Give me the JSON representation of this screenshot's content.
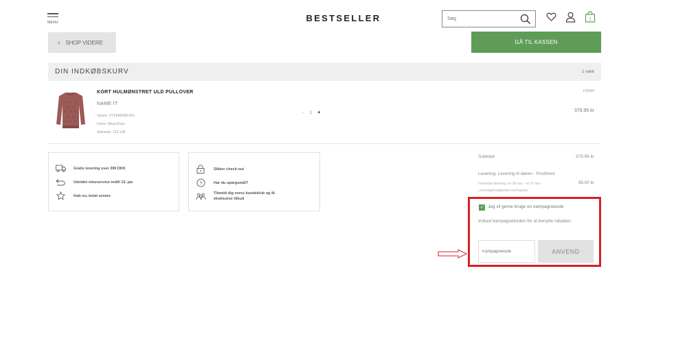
{
  "header": {
    "menu_label": "MENU",
    "logo": "BESTSELLER",
    "search_placeholder": "Søg"
  },
  "actions": {
    "shop_videre": "SHOP VIDERE",
    "checkout": "GÅ TIL KASSEN"
  },
  "cart": {
    "title": "DIN INDKØBSKURV",
    "count": "1 vare",
    "item": {
      "name": "KORT HULMØNSTRET ULD PULLOVER",
      "brand": "NAME IT",
      "item_no": "Varenr.: 5714489981419",
      "color": "Farve: Mesa Rose",
      "size": "Størrelse: 122-128",
      "qty_minus": "-",
      "qty": "1",
      "qty_plus": "+",
      "remove": "FJERN",
      "price": "379,95 kr"
    }
  },
  "info_left": [
    {
      "icon": "truck-icon",
      "text": "Gratis levering over 399 DKK"
    },
    {
      "icon": "return-arrow-icon",
      "text": "Udvidet returservice indtil 15. jan"
    },
    {
      "icon": "star-icon",
      "text": "Køb nu, betal senere"
    }
  ],
  "info_right": [
    {
      "icon": "lock-icon",
      "text": "Sikker check-out"
    },
    {
      "icon": "question-icon",
      "text": "Har du spørgsmål?"
    },
    {
      "icon": "people-icon",
      "text_line1": "Tilmeld dig vores kundeklub og få",
      "text_line2": "eksklusive tilbud"
    }
  ],
  "summary": {
    "subtotal_label": "Subtotal",
    "subtotal_value": "379,95 kr",
    "delivery_label": "Levering: Levering til døren - PostNord",
    "delivery_expected": "Forventet levering: on 06 nov. - to 07 nov.",
    "delivery_value": "39,00 kr",
    "delivery_options": "Leveringsmuligheder ved kassen"
  },
  "campaign": {
    "checkbox_label": "Jeg vil gerne bruge en kampagnekode",
    "checked": true,
    "description": "Indtast kampagnekoden for at benytte rabatten.",
    "input_placeholder": "Kampagnekode",
    "apply": "ANVEND"
  },
  "colors": {
    "accent_green": "#5e9c58",
    "highlight_red": "#d61f26"
  }
}
